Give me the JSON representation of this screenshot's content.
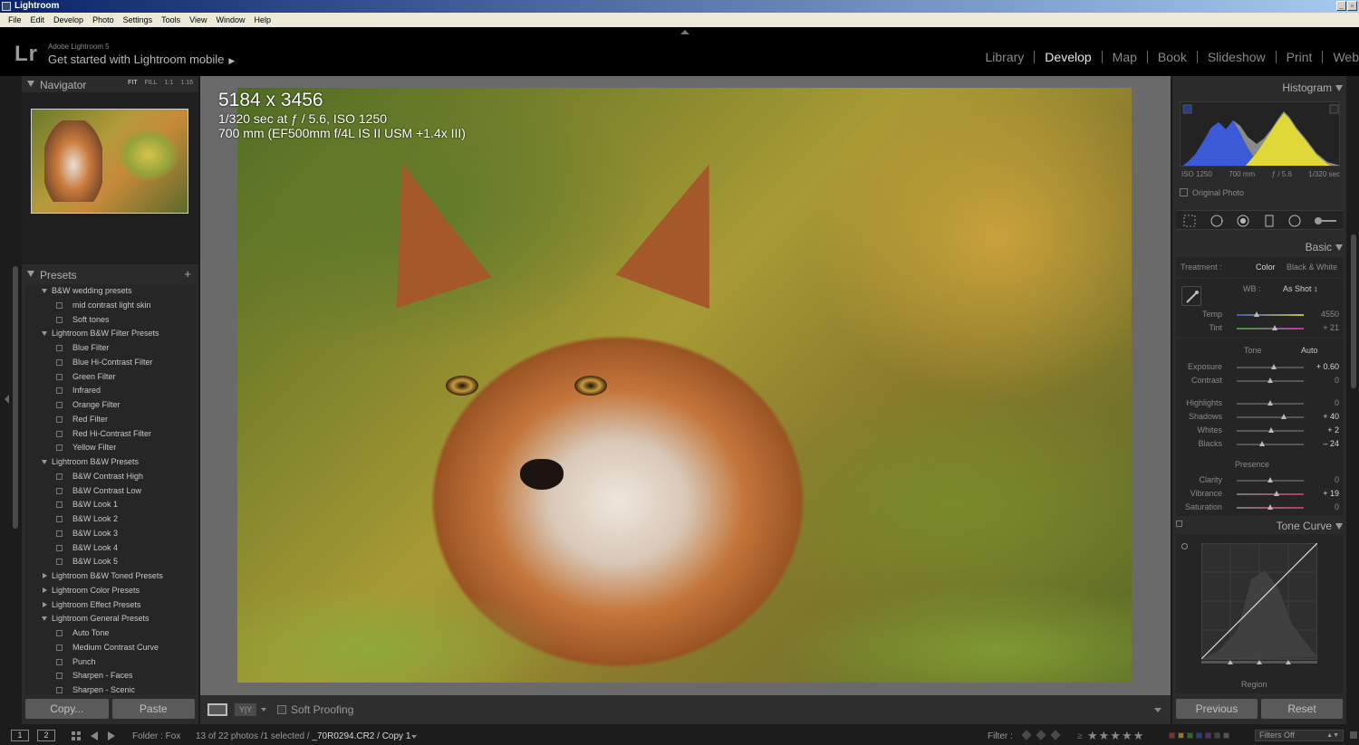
{
  "window": {
    "title": "Lightroom"
  },
  "menu": [
    "File",
    "Edit",
    "Develop",
    "Photo",
    "Settings",
    "Tools",
    "View",
    "Window",
    "Help"
  ],
  "identity": {
    "logo": "Lr",
    "version": "Adobe Lightroom 5",
    "mobile": "Get started with Lightroom mobile"
  },
  "modules": [
    {
      "label": "Library",
      "active": false
    },
    {
      "label": "Develop",
      "active": true
    },
    {
      "label": "Map",
      "active": false
    },
    {
      "label": "Book",
      "active": false
    },
    {
      "label": "Slideshow",
      "active": false
    },
    {
      "label": "Print",
      "active": false
    },
    {
      "label": "Web",
      "active": false
    }
  ],
  "navigator": {
    "title": "Navigator",
    "zoom": [
      "FIT",
      "FILL",
      "1:1",
      "1:16"
    ],
    "active_zoom": "FIT"
  },
  "presets": {
    "title": "Presets",
    "rows": [
      {
        "type": "folder",
        "open": true,
        "label": "B&W wedding presets"
      },
      {
        "type": "item",
        "label": "mid contrast light skin"
      },
      {
        "type": "item",
        "label": "Soft tones"
      },
      {
        "type": "folder",
        "open": true,
        "label": "Lightroom B&W Filter Presets"
      },
      {
        "type": "item",
        "label": "Blue Filter"
      },
      {
        "type": "item",
        "label": "Blue Hi-Contrast Filter"
      },
      {
        "type": "item",
        "label": "Green Filter"
      },
      {
        "type": "item",
        "label": "Infrared"
      },
      {
        "type": "item",
        "label": "Orange Filter"
      },
      {
        "type": "item",
        "label": "Red Filter"
      },
      {
        "type": "item",
        "label": "Red Hi-Contrast Filter"
      },
      {
        "type": "item",
        "label": "Yellow Filter"
      },
      {
        "type": "folder",
        "open": true,
        "label": "Lightroom B&W Presets"
      },
      {
        "type": "item",
        "label": "B&W Contrast High"
      },
      {
        "type": "item",
        "label": "B&W Contrast Low"
      },
      {
        "type": "item",
        "label": "B&W Look 1"
      },
      {
        "type": "item",
        "label": "B&W Look 2"
      },
      {
        "type": "item",
        "label": "B&W Look 3"
      },
      {
        "type": "item",
        "label": "B&W Look 4"
      },
      {
        "type": "item",
        "label": "B&W Look 5"
      },
      {
        "type": "folder",
        "open": false,
        "label": "Lightroom B&W Toned Presets"
      },
      {
        "type": "folder",
        "open": false,
        "label": "Lightroom Color Presets"
      },
      {
        "type": "folder",
        "open": false,
        "label": "Lightroom Effect Presets"
      },
      {
        "type": "folder",
        "open": true,
        "label": "Lightroom General Presets"
      },
      {
        "type": "item",
        "label": "Auto Tone"
      },
      {
        "type": "item",
        "label": "Medium Contrast Curve"
      },
      {
        "type": "item",
        "label": "Punch"
      },
      {
        "type": "item",
        "label": "Sharpen - Faces"
      },
      {
        "type": "item",
        "label": "Sharpen - Scenic"
      }
    ]
  },
  "left_buttons": {
    "copy": "Copy...",
    "paste": "Paste"
  },
  "photo_info": {
    "dimensions": "5184 x 3456",
    "exposure": "1/320 sec at ƒ / 5.6, ISO 1250",
    "lens": "700 mm (EF500mm f/4L IS II USM +1.4x III)"
  },
  "toolbar": {
    "soft_proofing": "Soft Proofing",
    "yy": "Y|Y"
  },
  "histogram": {
    "title": "Histogram",
    "iso": "ISO 1250",
    "focal": "700 mm",
    "aperture": "ƒ / 5.6",
    "shutter": "1/320 sec",
    "original_photo": "Original Photo"
  },
  "basic": {
    "title": "Basic",
    "treatment_label": "Treatment :",
    "color": "Color",
    "bw": "Black & White",
    "wb_label": "WB :",
    "wb_value": "As Shot ↕",
    "tone_label": "Tone",
    "auto": "Auto",
    "presence_label": "Presence",
    "sliders": {
      "temp": {
        "label": "Temp",
        "value": "4550",
        "pos": 0.3
      },
      "tint": {
        "label": "Tint",
        "value": "+ 21",
        "pos": 0.57
      },
      "exposure": {
        "label": "Exposure",
        "value": "+ 0.60",
        "pos": 0.56
      },
      "contrast": {
        "label": "Contrast",
        "value": "0",
        "pos": 0.5
      },
      "highlights": {
        "label": "Highlights",
        "value": "0",
        "pos": 0.5
      },
      "shadows": {
        "label": "Shadows",
        "value": "+ 40",
        "pos": 0.7
      },
      "whites": {
        "label": "Whites",
        "value": "+ 2",
        "pos": 0.51
      },
      "blacks": {
        "label": "Blacks",
        "value": "– 24",
        "pos": 0.38
      },
      "clarity": {
        "label": "Clarity",
        "value": "0",
        "pos": 0.5
      },
      "vibrance": {
        "label": "Vibrance",
        "value": "+ 19",
        "pos": 0.6
      },
      "saturation": {
        "label": "Saturation",
        "value": "0",
        "pos": 0.5
      }
    }
  },
  "tone_curve": {
    "title": "Tone Curve",
    "region": "Region"
  },
  "right_buttons": {
    "previous": "Previous",
    "reset": "Reset"
  },
  "filmstrip": {
    "screen1": "1",
    "screen2": "2",
    "folder": "Folder : Fox",
    "count": "13 of 22 photos /1 selected /",
    "file": "_70R0294.CR2 / Copy 1",
    "filter": "Filter :",
    "ge": "≥",
    "stars": "★★★★★",
    "filters_off": "Filters Off"
  },
  "colors": {
    "accent": "#e8e8e8",
    "panel": "#2b2b2b",
    "center_bg": "#6a6a6a"
  }
}
